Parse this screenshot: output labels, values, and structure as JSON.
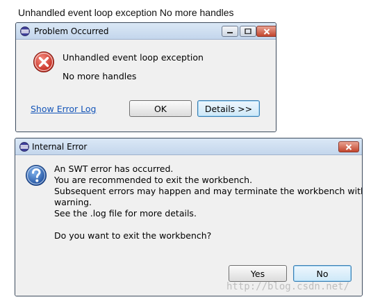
{
  "caption": "Unhandled event loop exception No more handles",
  "problem_dialog": {
    "title": "Problem Occurred",
    "message_line1": "Unhandled event loop exception",
    "message_line2": "No more handles",
    "show_error_log_link": "Show Error Log",
    "ok_button": "OK",
    "details_button": "Details >>",
    "icon": "error-icon"
  },
  "internal_error_dialog": {
    "title": "Internal Error",
    "lines": [
      "An SWT error has occurred.",
      "You are recommended to exit the workbench.",
      "Subsequent errors may happen and may terminate the workbench without",
      "warning.",
      "See the .log file for more details.",
      "",
      "Do you want to exit the workbench?"
    ],
    "yes_button": "Yes",
    "no_button": "No",
    "icon": "question-icon"
  },
  "watermark": "http://blog.csdn.net/",
  "colors": {
    "link": "#1455b8",
    "error_red": "#d32f2f",
    "question_blue": "#2a5fb0",
    "close_button": "#c2452d"
  }
}
